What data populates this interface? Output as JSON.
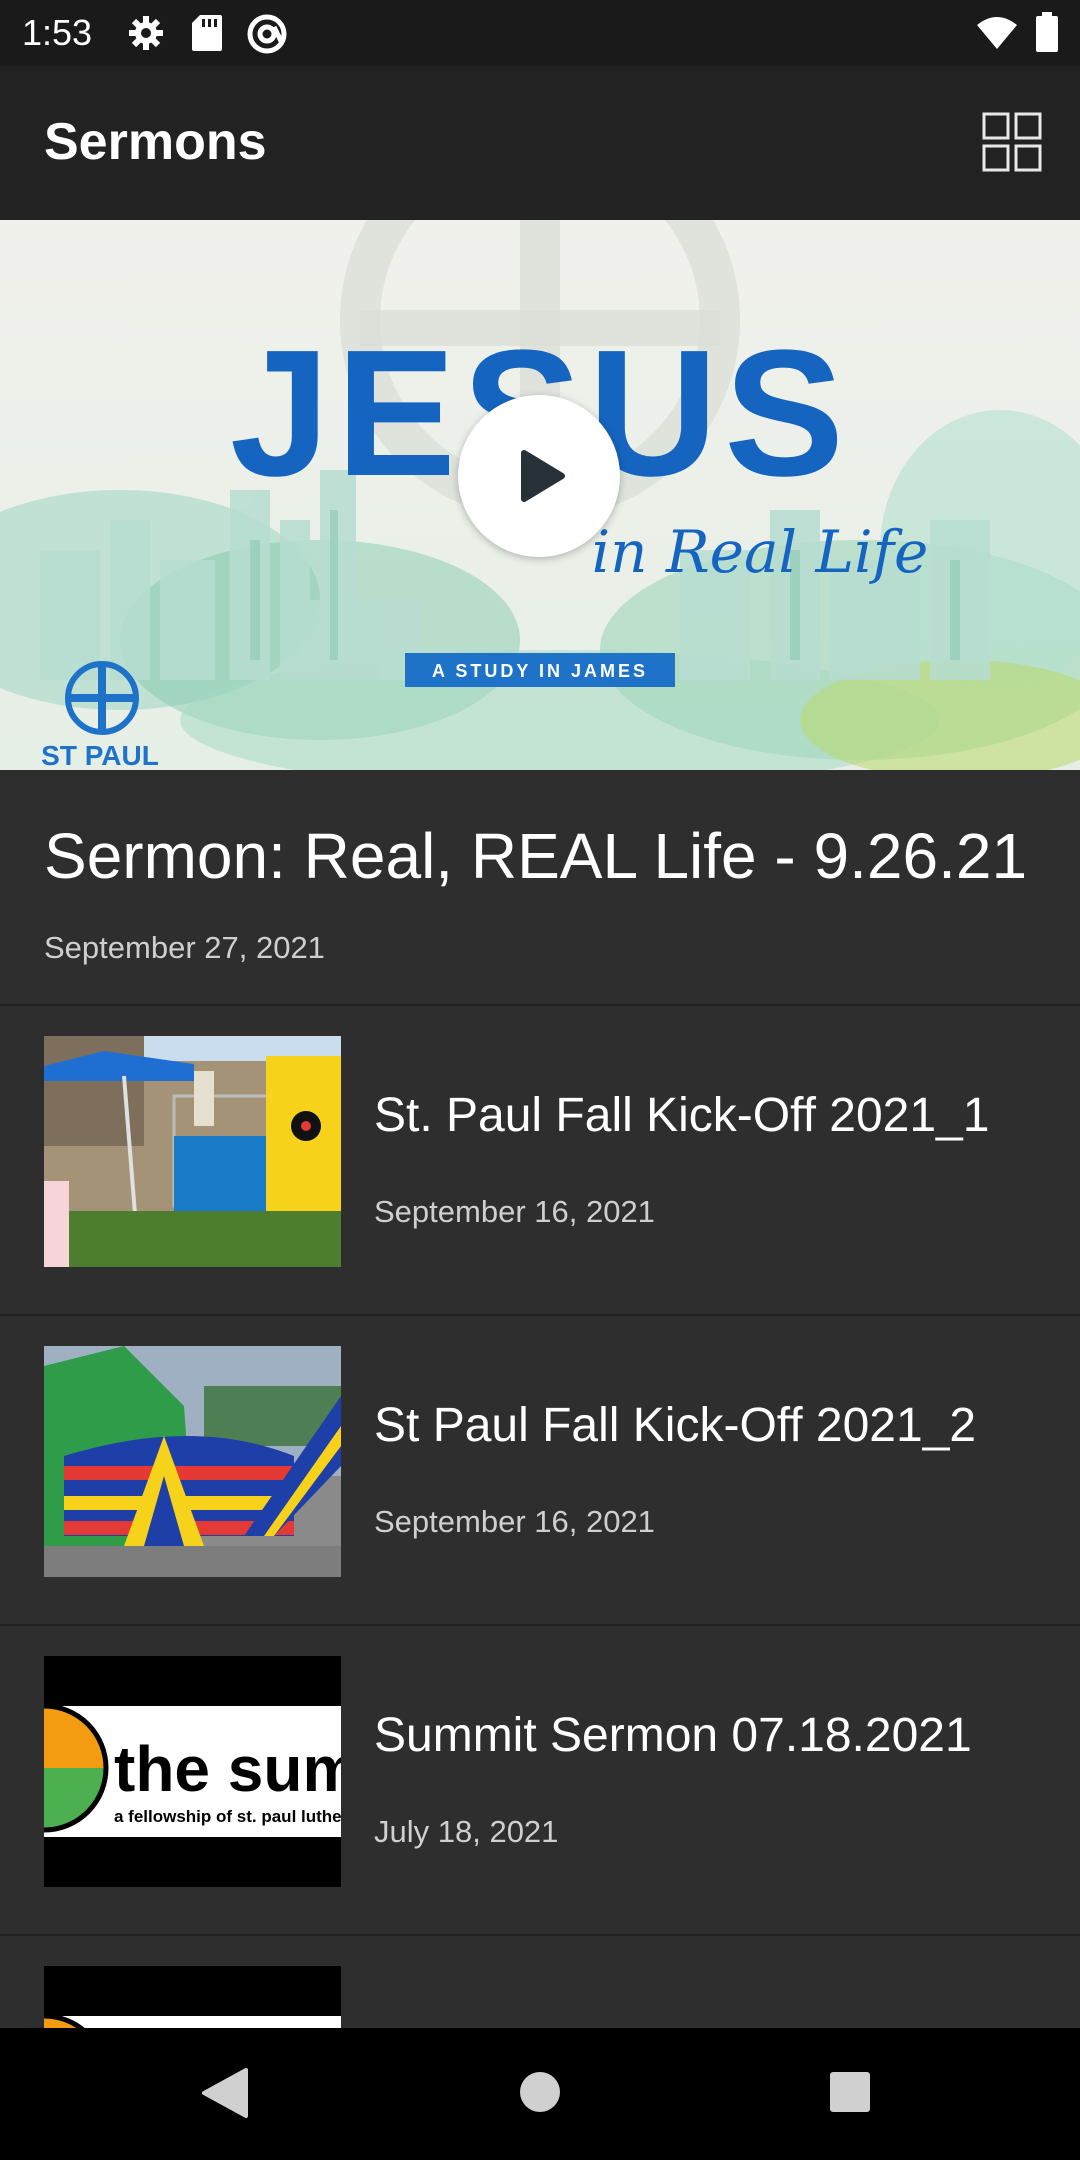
{
  "status_bar": {
    "time": "1:53",
    "left_icons": [
      "settings-icon",
      "sd-card-icon",
      "at-sign-icon"
    ],
    "right_icons": [
      "wifi-icon",
      "battery-icon"
    ]
  },
  "app_bar": {
    "title": "Sermons",
    "grid_icon": "grid-view-icon"
  },
  "hero": {
    "artwork_headline": "JESUS",
    "artwork_subtitle": "in Real Life",
    "artwork_banner": "A STUDY IN JAMES",
    "artwork_logo": "ST PAUL",
    "play_icon": "play-icon"
  },
  "featured": {
    "title": "Sermon: Real, REAL Life - 9.26.21",
    "date": "September 27, 2021"
  },
  "list": [
    {
      "title": "St. Paul Fall Kick-Off 2021_1",
      "date": "September 16, 2021"
    },
    {
      "title": "St Paul Fall Kick-Off 2021_2",
      "date": "September 16, 2021"
    },
    {
      "title": "Summit Sermon 07.18.2021",
      "date": "July 18, 2021",
      "thumb_text": "the summ",
      "thumb_subtext": "a fellowship of st. paul lutheran"
    }
  ],
  "nav_bar": {
    "icons": [
      "back-icon",
      "home-icon",
      "recents-icon"
    ]
  },
  "colors": {
    "background": "#2a2a2b",
    "app_bar": "#222222",
    "accent_blue": "#1565c0"
  }
}
